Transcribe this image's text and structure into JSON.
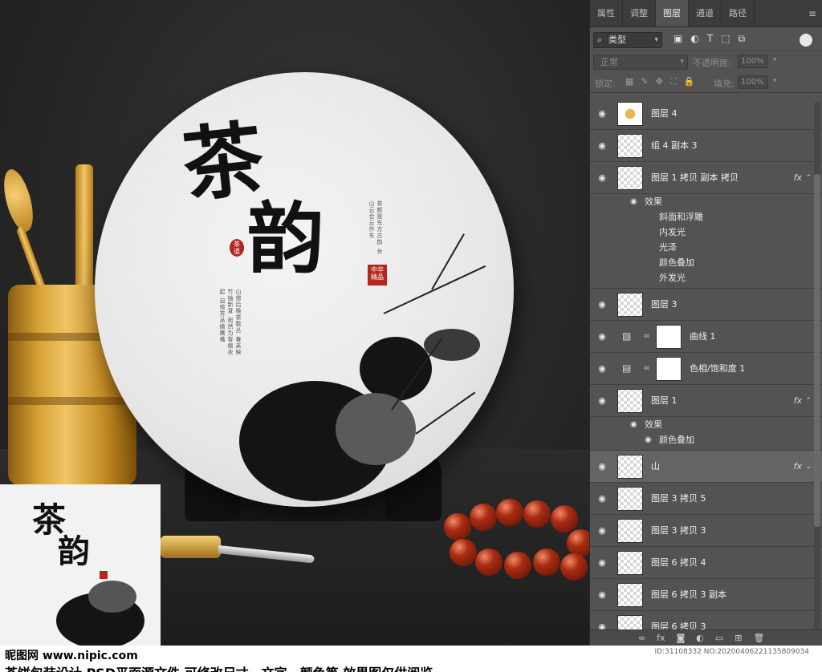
{
  "canvas": {
    "cake_title_line1": "茶",
    "cake_title_line2": "韵",
    "seal_small": "茶道",
    "seal_main": "中华 精品",
    "poem_right": "茶颜是东方古韵 台山云合云作车",
    "poem_left": "山僧后檐茶数丛 春来映竹抽新茸 宛然为客振衣起 自傍芳丛摘鹰嘴"
  },
  "thumbnail": {
    "title_line1": "茶",
    "title_line2": "韵"
  },
  "footer": {
    "logo": "昵图网 www.nipic.com",
    "description": "茶饼包装设计  PSD平面源文件  可修改尺寸、文字、颜色等  效果图仅供阅览",
    "id_text": "ID:31108332 NO:20200406221135809034"
  },
  "panel": {
    "tabs": [
      "属性",
      "调整",
      "图层",
      "通道",
      "路径"
    ],
    "active_tab": "图层",
    "filter_label": "类型",
    "blend_mode": "正常",
    "opacity_label": "不透明度:",
    "opacity_value": "100%",
    "lock_label": "锁定:",
    "fill_label": "填充:",
    "fill_value": "100%",
    "layers": [
      {
        "name": "图层 4",
        "type": "pixel",
        "thumb": "gold"
      },
      {
        "name": "组 4 副本 3",
        "type": "pixel"
      },
      {
        "name": "图层 1 拷贝 副本 拷贝",
        "type": "pixel",
        "fx": true,
        "effects_label": "效果",
        "effects": [
          "斜面和浮雕",
          "内发光",
          "光泽",
          "颜色叠加",
          "外发光"
        ]
      },
      {
        "name": "图层 3",
        "type": "pixel"
      },
      {
        "name": "曲线 1",
        "type": "adjustment",
        "icon": "curves-icon"
      },
      {
        "name": "色相/饱和度 1",
        "type": "adjustment",
        "icon": "hue-sat-icon"
      },
      {
        "name": "图层 1",
        "type": "pixel",
        "fx": true,
        "effects_label": "效果",
        "effects": [
          "颜色叠加"
        ]
      },
      {
        "name": "山",
        "type": "pixel",
        "fx": true,
        "selected": true
      },
      {
        "name": "图层 3 拷贝 5",
        "type": "pixel"
      },
      {
        "name": "图层 3 拷贝 3",
        "type": "pixel"
      },
      {
        "name": "图层 6 拷贝 4",
        "type": "pixel"
      },
      {
        "name": "图层 6 拷贝 3 副本",
        "type": "pixel"
      },
      {
        "name": "图层 6 拷贝 3",
        "type": "pixel"
      }
    ],
    "fx_label": "fx",
    "bottom_icons": [
      "link-icon",
      "fx-icon",
      "mask-icon",
      "adjustment-icon",
      "folder-icon",
      "new-layer-icon",
      "trash-icon"
    ]
  },
  "colors": {
    "panel_bg": "#535353",
    "seal_red": "#b3261e",
    "bead_red": "#a92c12"
  }
}
